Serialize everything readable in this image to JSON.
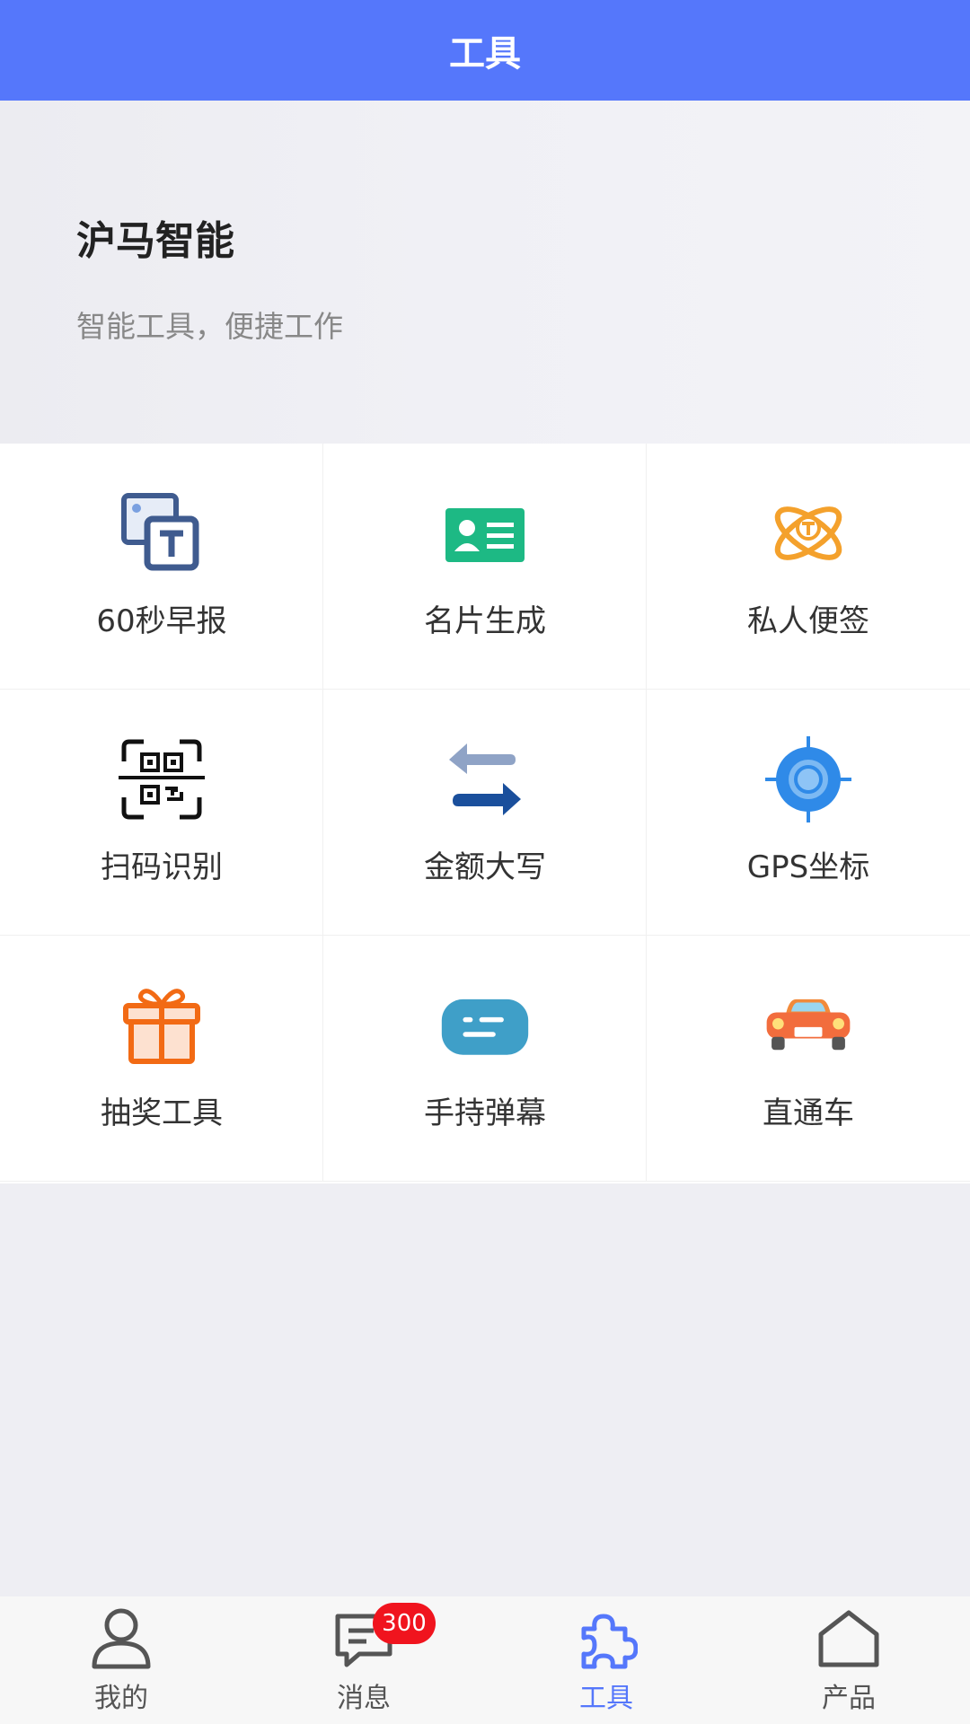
{
  "header": {
    "title": "工具"
  },
  "banner": {
    "title": "沪马智能",
    "subtitle": "智能工具，便捷工作"
  },
  "tools": [
    {
      "label": "60秒早报",
      "icon": "news-image-text-icon"
    },
    {
      "label": "名片生成",
      "icon": "business-card-icon"
    },
    {
      "label": "私人便签",
      "icon": "atom-note-icon"
    },
    {
      "label": "扫码识别",
      "icon": "qr-scan-icon"
    },
    {
      "label": "金额大写",
      "icon": "exchange-arrows-icon"
    },
    {
      "label": "GPS坐标",
      "icon": "gps-target-icon"
    },
    {
      "label": "抽奖工具",
      "icon": "gift-icon"
    },
    {
      "label": "手持弹幕",
      "icon": "chat-bubble-icon"
    },
    {
      "label": "直通车",
      "icon": "car-icon"
    }
  ],
  "tabbar": {
    "items": [
      {
        "label": "我的",
        "icon": "user-icon"
      },
      {
        "label": "消息",
        "icon": "message-icon",
        "badge": "300"
      },
      {
        "label": "工具",
        "icon": "puzzle-icon"
      },
      {
        "label": "产品",
        "icon": "home-icon"
      }
    ],
    "active_index": 2
  },
  "colors": {
    "accent": "#5577fb",
    "badge": "#f0141e"
  }
}
